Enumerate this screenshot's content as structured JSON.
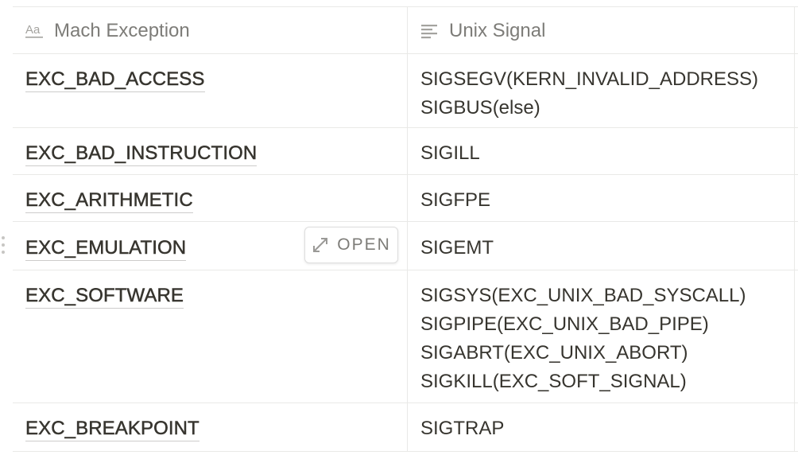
{
  "table": {
    "columns": [
      {
        "label": "Mach Exception",
        "icon": "text-title-icon"
      },
      {
        "label": "Unix Signal",
        "icon": "text-lines-icon"
      }
    ],
    "rows": [
      {
        "exception": "EXC_BAD_ACCESS",
        "signals": [
          "SIGSEGV(KERN_INVALID_ADDRESS)",
          "SIGBUS(else)"
        ]
      },
      {
        "exception": "EXC_BAD_INSTRUCTION",
        "signals": [
          "SIGILL"
        ]
      },
      {
        "exception": "EXC_ARITHMETIC",
        "signals": [
          "SIGFPE"
        ]
      },
      {
        "exception": "EXC_EMULATION",
        "signals": [
          "SIGEMT"
        ],
        "open_label": "OPEN"
      },
      {
        "exception": "EXC_SOFTWARE",
        "signals": [
          "SIGSYS(EXC_UNIX_BAD_SYSCALL)",
          "SIGPIPE(EXC_UNIX_BAD_PIPE)",
          "SIGABRT(EXC_UNIX_ABORT)",
          "SIGKILL(EXC_SOFT_SIGNAL)"
        ]
      },
      {
        "exception": "EXC_BREAKPOINT",
        "signals": [
          "SIGTRAP"
        ]
      }
    ]
  },
  "colors": {
    "text": "#37352f",
    "border": "#e9e9e7",
    "muted": "#8a8985"
  }
}
